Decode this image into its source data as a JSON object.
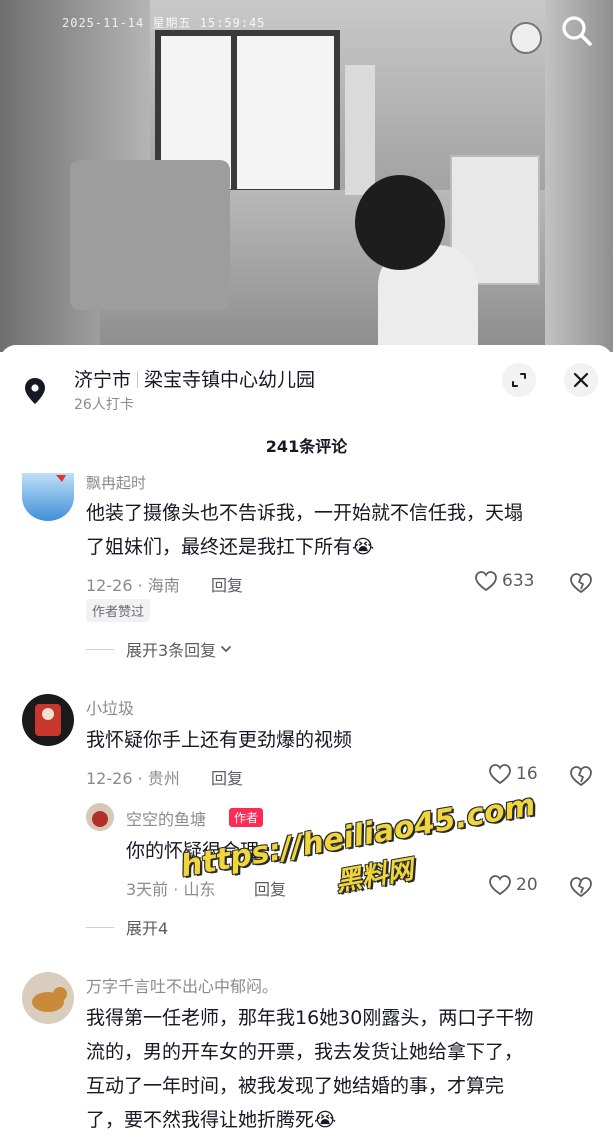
{
  "video": {
    "timestamp": "2025-11-14  星期五  15:59:45"
  },
  "location": {
    "city": "济宁市",
    "place": "梁宝寺镇中心幼儿园",
    "checkins": "26人打卡"
  },
  "comments_header": "241条评论",
  "comments": [
    {
      "username": "飘冉起时",
      "text_line1": "他装了摄像头也不告诉我，一开始就不信任我，天塌",
      "text_line2": "了姐妹们，最终还是我扛下所有😭",
      "date_region": "12-26 · 海南",
      "reply": "回复",
      "likes": "633",
      "badge": "作者赞过",
      "expand": "展开3条回复"
    },
    {
      "username": "小垃圾",
      "text": "我怀疑你手上还有更劲爆的视频",
      "date_region": "12-26 · 贵州",
      "reply": "回复",
      "likes": "16",
      "sub_reply": {
        "username": "空空的鱼塘",
        "author_tag": "作者",
        "text": "你的怀疑很合理",
        "date_region": "3天前 · 山东",
        "reply": "回复",
        "likes": "20"
      },
      "expand": "展开4"
    },
    {
      "username": "万字千言吐不出心中郁闷。",
      "text_line1": "我得第一任老师，那年我16她30刚露头，两口子干物",
      "text_line2": "流的，男的开车女的开票，我去发货让她给拿下了，",
      "text_line3": "互动了一年时间，被我发现了她结婚的事，才算完",
      "text_line4": "了，要不然我得让她折腾死😭"
    }
  ],
  "watermark": {
    "url": "https://heiliao45.com",
    "name": "黑料网"
  },
  "colors": {
    "accent_red": "#fe2c55",
    "text_primary": "#161823",
    "text_secondary": "#8a8b91",
    "watermark_yellow": "#f0d63a"
  }
}
